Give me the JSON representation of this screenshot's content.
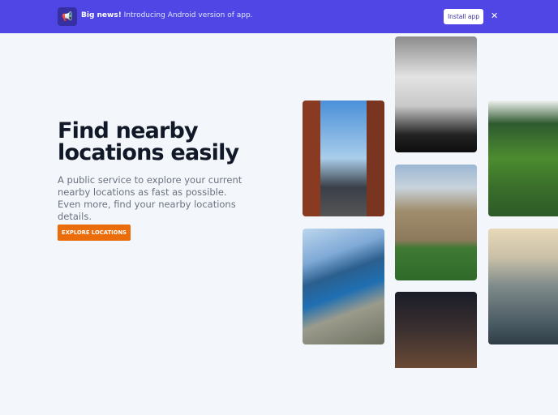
{
  "banner": {
    "icon": "megaphone-icon",
    "headline": "Big news!",
    "message": " Introducing Android version of app.",
    "install_label": "Install app",
    "close_icon": "close-icon",
    "close_label": "✕"
  },
  "hero": {
    "title": "Find nearby locations easily",
    "description": "A public service to explore your current nearby locations as fast as possible. Even more, find your nearby locations details.",
    "cta_label": "EXPLORE LOCATIONS"
  },
  "colors": {
    "banner": "#4f46e5",
    "cta": "#ea6c0a",
    "title": "#111827"
  }
}
